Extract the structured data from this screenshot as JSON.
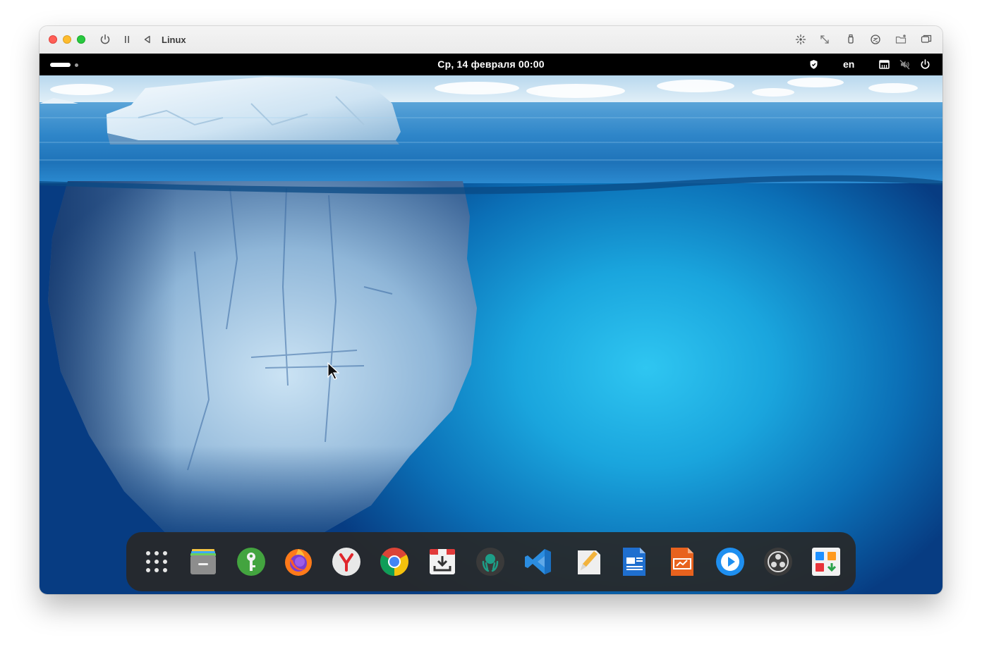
{
  "window": {
    "title": "Linux"
  },
  "toolbar": {
    "left_icons": [
      "power-icon",
      "pause-icon",
      "back-triangle-icon"
    ],
    "right_icons": [
      "brightness-icon",
      "resize-arrows-icon",
      "usb-icon",
      "network-share-icon",
      "shared-folder-icon",
      "windows-icon"
    ]
  },
  "topbar": {
    "datetime": "Ср, 14 февраля  00:00",
    "language": "en",
    "tray_icons": [
      "shield-icon",
      "network-wired-icon",
      "sound-muted-icon",
      "power-icon"
    ]
  },
  "dock": {
    "apps": [
      {
        "name": "Show Applications",
        "icon": "app-grid-icon"
      },
      {
        "name": "Files",
        "icon": "file-cabinet-icon"
      },
      {
        "name": "Passwords and Keys",
        "icon": "key-icon"
      },
      {
        "name": "Firefox",
        "icon": "firefox-icon"
      },
      {
        "name": "Yandex Browser",
        "icon": "yandex-icon"
      },
      {
        "name": "Google Chrome",
        "icon": "chrome-icon"
      },
      {
        "name": "Download Manager",
        "icon": "download-box-icon"
      },
      {
        "name": "GitKraken",
        "icon": "gitkraken-icon"
      },
      {
        "name": "Visual Studio Code",
        "icon": "vscode-icon"
      },
      {
        "name": "Text Editor",
        "icon": "text-editor-icon"
      },
      {
        "name": "Writer",
        "icon": "writer-document-icon"
      },
      {
        "name": "Presentation",
        "icon": "presentation-icon"
      },
      {
        "name": "Media Player",
        "icon": "play-circle-icon"
      },
      {
        "name": "OBS Studio",
        "icon": "obs-icon"
      },
      {
        "name": "Software Center",
        "icon": "software-center-icon"
      }
    ]
  },
  "colors": {
    "topbar_bg": "#000000",
    "dock_bg": "#282828",
    "close": "#ff5f57",
    "minimize": "#febc2e",
    "maximize": "#28c840"
  }
}
